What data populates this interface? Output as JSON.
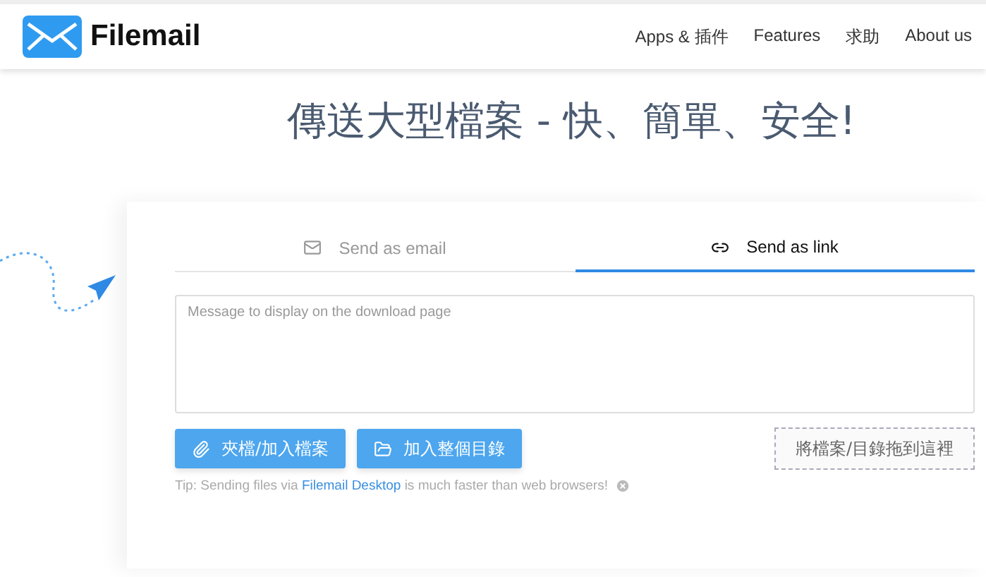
{
  "header": {
    "logo": "Filemail",
    "nav": [
      "Apps & 插件",
      "Features",
      "求助",
      "About us"
    ]
  },
  "headline": "傳送大型檔案 - 快、簡單、安全!",
  "tabs": [
    {
      "label": "Send as email",
      "kind": "email",
      "selected": false
    },
    {
      "label": "Send as link",
      "kind": "link",
      "selected": true
    }
  ],
  "message": {
    "placeholder": "Message to display on the download page"
  },
  "buttons": [
    {
      "label": "夾檔/加入檔案",
      "kind": "attach"
    },
    {
      "label": "加入整個目錄",
      "kind": "folder"
    }
  ],
  "drop_zone": "將檔案/目錄拖到這裡",
  "tip": {
    "before": "Tip: Sending files via",
    "link": "Filemail Desktop",
    "after": "is much faster than web browsers!"
  }
}
